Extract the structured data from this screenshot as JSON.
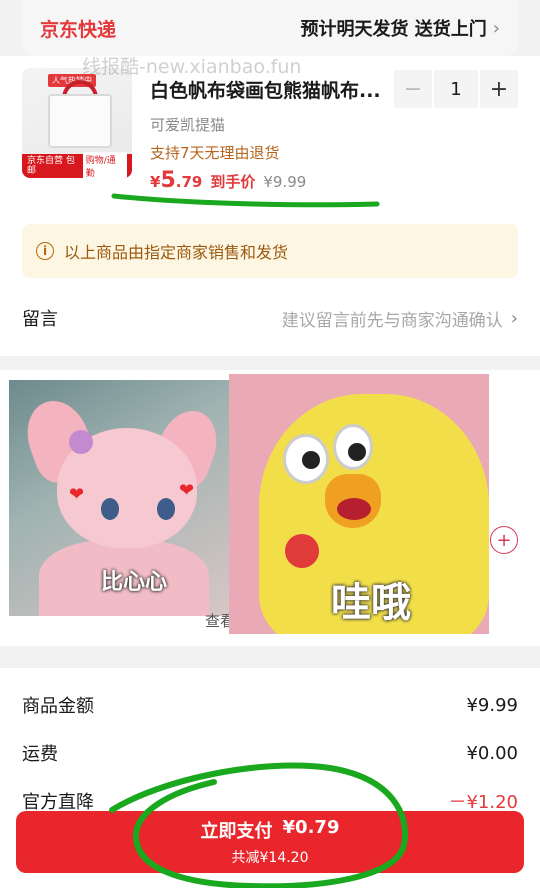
{
  "delivery": {
    "brand": "京东快递",
    "info": "预计明天发货 送货上门"
  },
  "watermark": "线报酷-new.xianbao.fun",
  "product": {
    "thumb_hot": "人气热销中",
    "thumb_tag_left": "京东自营 包邮",
    "thumb_tag_right": "购物/通勤",
    "title": "白色帆布袋画包熊猫帆布...",
    "variant": "可爱凯提猫",
    "return_policy": "支持7天无理由退货",
    "price_currency": "¥",
    "price_int": "5",
    "price_dec": ".79",
    "price_tag": "到手价",
    "price_original": "¥9.99",
    "quantity": "1",
    "minus": "−",
    "plus": "+"
  },
  "notice": {
    "text": "以上商品由指定商家销售和发货",
    "icon": "info-icon"
  },
  "message": {
    "label": "留言",
    "hint": "建议留言前先与商家沟通确认"
  },
  "stickers": {
    "left_caption": "比心心",
    "right_caption": "哇哦",
    "under_text": "查看"
  },
  "summary": {
    "items": [
      {
        "label": "商品金额",
        "value": "¥9.99"
      },
      {
        "label": "运费",
        "value": "¥0.00"
      },
      {
        "label": "官方直降",
        "value": "－¥1.20"
      }
    ]
  },
  "pay": {
    "label": "立即支付",
    "amount": "¥0.79",
    "sub": "共减¥14.20"
  },
  "colors": {
    "accent": "#e4393c",
    "notice_bg": "#fdf6e3",
    "pay_bg": "#e8262b"
  }
}
